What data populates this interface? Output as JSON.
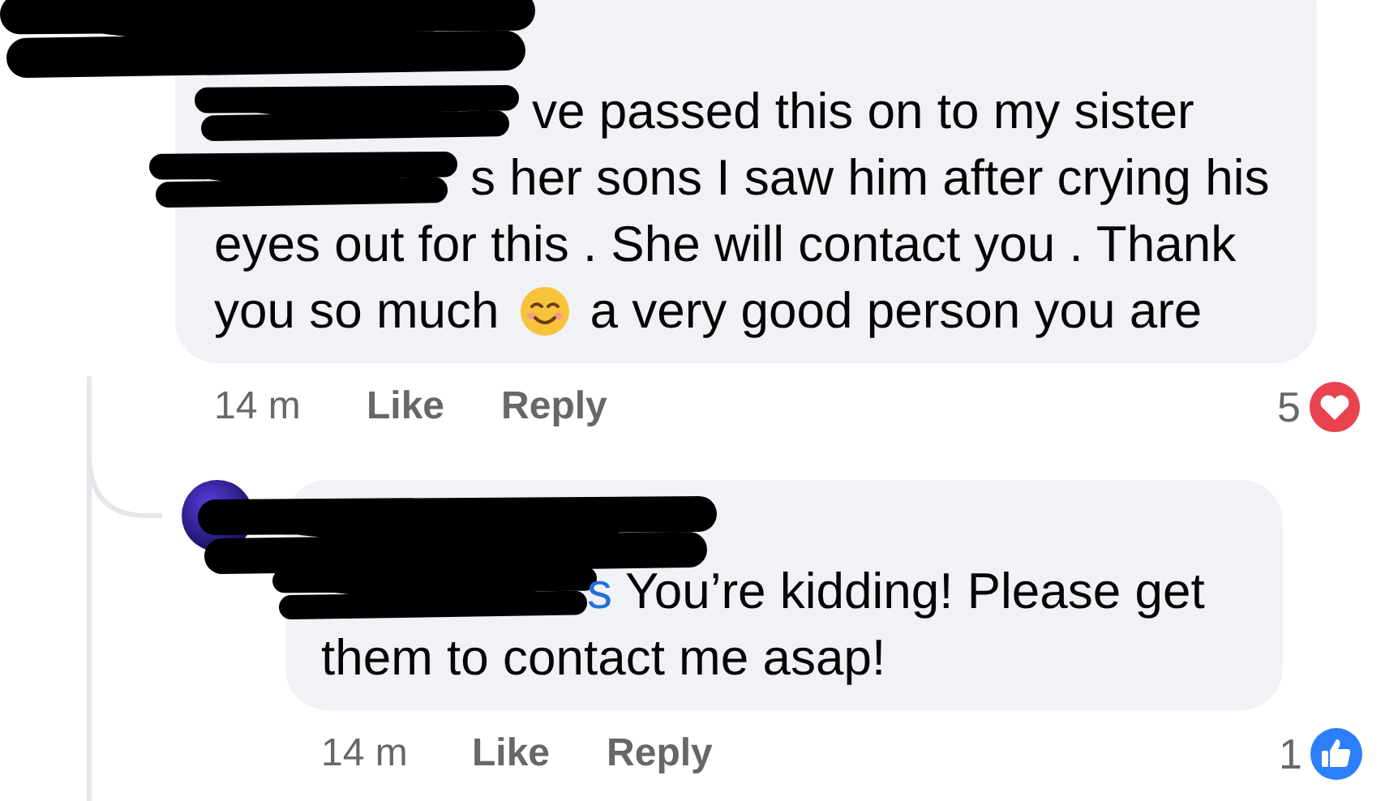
{
  "comments": [
    {
      "name_redacted": true,
      "lines": [
        {
          "redacted": true,
          "segments": [
            {
              "kind": "text",
              "text": "ve passed this on to my sister"
            }
          ]
        },
        {
          "redacted": true,
          "segments": [
            {
              "kind": "text",
              "text": "s her sons I saw him after crying his"
            }
          ]
        },
        {
          "redacted": false,
          "segments": [
            {
              "kind": "text",
              "text": "eyes out for this . She will contact you . Thank"
            }
          ]
        },
        {
          "redacted": false,
          "segments": [
            {
              "kind": "text",
              "text": "you so much"
            },
            {
              "kind": "emoji"
            },
            {
              "kind": "text",
              "text": "a very good person you are"
            }
          ]
        }
      ],
      "time": "14 m",
      "actions": [
        "Like",
        "Reply"
      ],
      "reaction": {
        "count": "5",
        "kind": "love"
      }
    },
    {
      "name_redacted": true,
      "name_fragment": "s",
      "lines": [
        {
          "redacted": true,
          "segments": [
            {
              "kind": "text",
              "text": "You’re kidding! Please get"
            }
          ]
        },
        {
          "redacted": false,
          "segments": [
            {
              "kind": "text",
              "text": "them to contact me asap!"
            }
          ]
        }
      ],
      "time": "14 m",
      "actions": [
        "Like",
        "Reply"
      ],
      "reaction": {
        "count": "1",
        "kind": "like"
      }
    }
  ]
}
